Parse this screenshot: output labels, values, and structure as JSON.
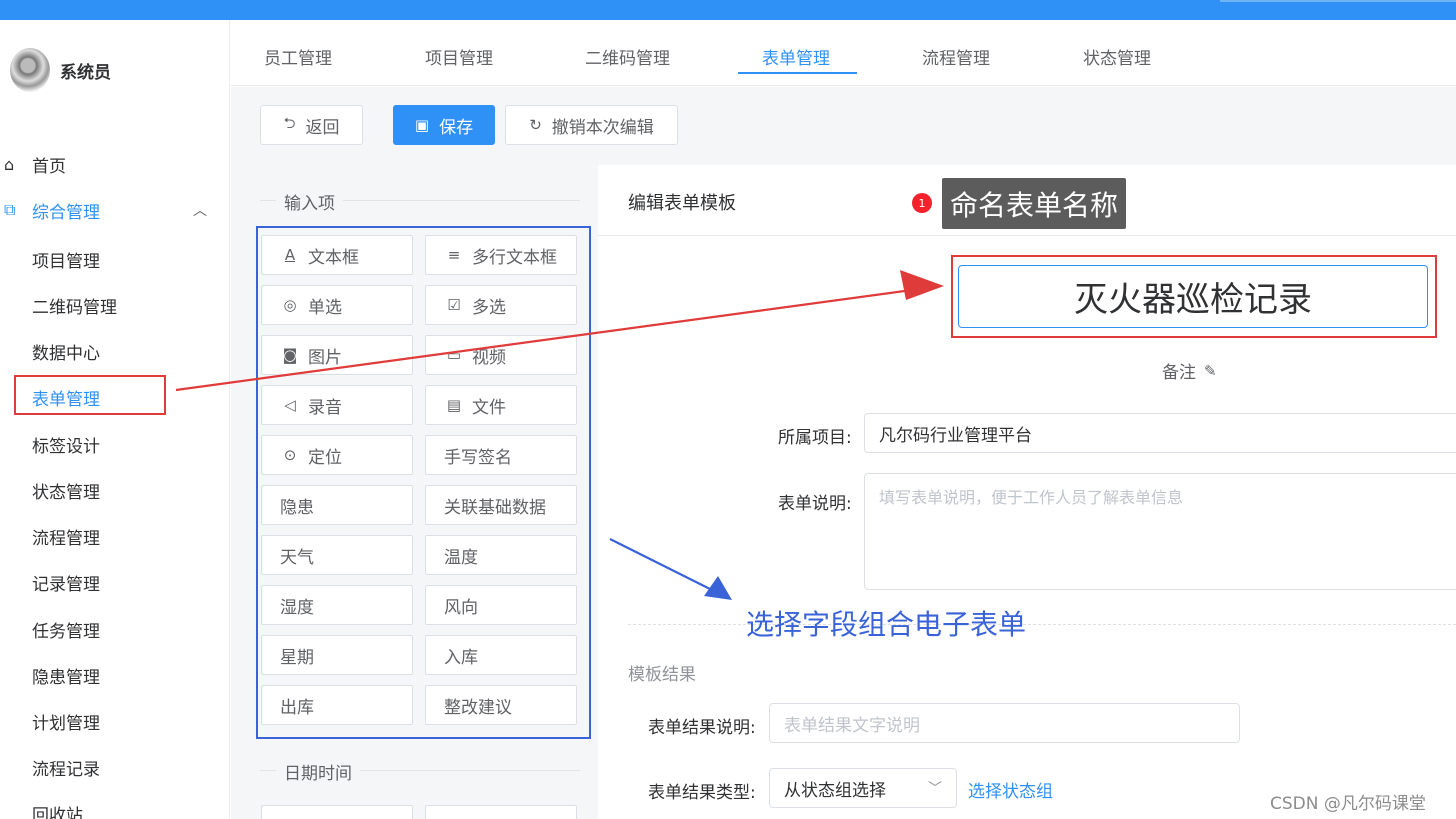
{
  "colors": {
    "primary": "#2f91f5",
    "annotation_red": "#e03b3b",
    "annotation_blue": "#3a63d8"
  },
  "user": {
    "name": "系统员"
  },
  "sidebar": {
    "home": {
      "label": "首页",
      "icon": "home-icon"
    },
    "group": {
      "label": "综合管理",
      "icon": "copy-icon",
      "expanded": true
    },
    "items": [
      "项目管理",
      "二维码管理",
      "数据中心",
      "表单管理",
      "标签设计",
      "状态管理",
      "流程管理",
      "记录管理",
      "任务管理",
      "隐患管理",
      "计划管理",
      "流程记录",
      "回收站"
    ]
  },
  "tabs": [
    "员工管理",
    "项目管理",
    "二维码管理",
    "表单管理",
    "流程管理",
    "状态管理"
  ],
  "toolbar": {
    "back": "返回",
    "save": "保存",
    "undo": "撤销本次编辑"
  },
  "palette": {
    "input_section": "输入项",
    "date_section": "日期时间",
    "fields": [
      "文本框",
      "多行文本框",
      "单选",
      "多选",
      "图片",
      "视频",
      "录音",
      "文件",
      "定位",
      "手写签名",
      "隐患",
      "关联基础数据",
      "天气",
      "温度",
      "湿度",
      "风向",
      "星期",
      "入库",
      "出库",
      "整改建议"
    ]
  },
  "editor": {
    "title": "编辑表单模板",
    "form_name": "灭火器巡检记录",
    "remark": "备注",
    "project_label": "所属项目:",
    "project_value": "凡尔码行业管理平台",
    "desc_label": "表单说明:",
    "desc_placeholder": "填写表单说明，便于工作人员了解表单信息",
    "result_section": "模板结果",
    "result_desc_label": "表单结果说明:",
    "result_desc_placeholder": "表单结果文字说明",
    "result_type_label": "表单结果类型:",
    "result_type_value": "从状态组选择",
    "select_group_link": "选择状态组"
  },
  "annotations": {
    "badge": "1",
    "name_tip": "命名表单名称",
    "field_tip": "选择字段组合电子表单"
  },
  "watermark": "CSDN @凡尔码课堂"
}
